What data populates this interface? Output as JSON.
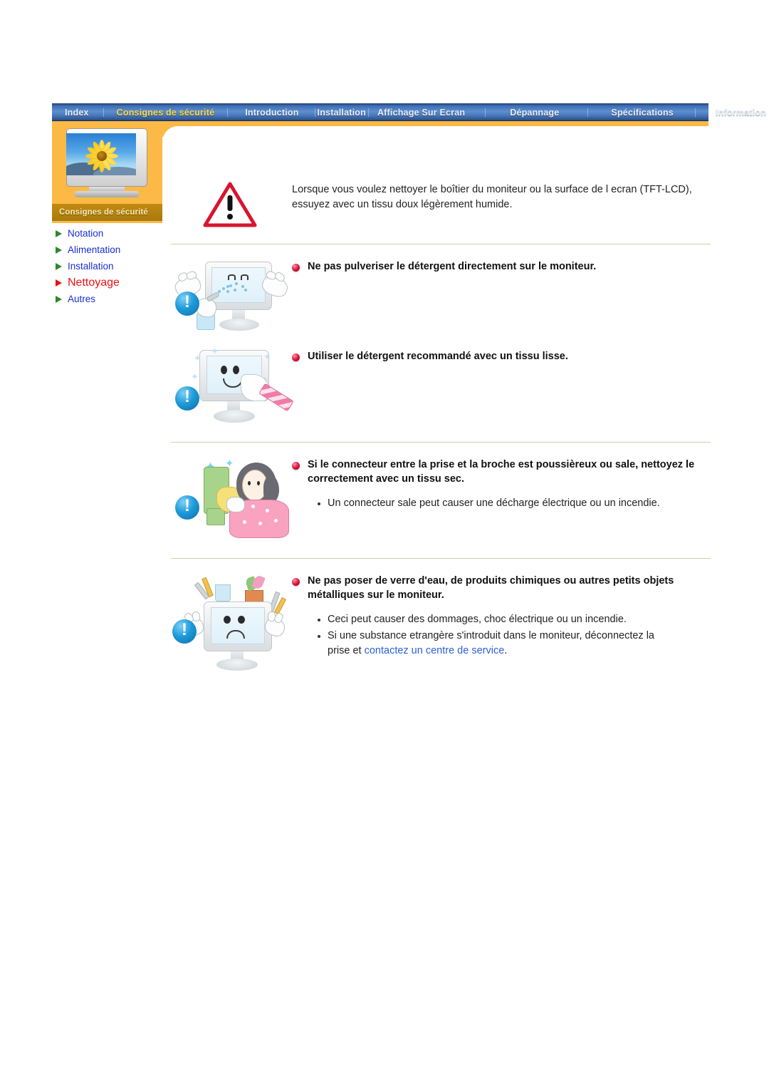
{
  "nav": {
    "items": [
      {
        "label": "Index",
        "active": false
      },
      {
        "label": "Consignes de sécurité",
        "active": true
      },
      {
        "label": "Introduction",
        "active": false
      },
      {
        "label": "Installation",
        "active": false
      },
      {
        "label": "Affichage Sur Ecran",
        "active": false
      },
      {
        "label": "Dépannage",
        "active": false
      },
      {
        "label": "Spécifications",
        "active": false
      },
      {
        "label": "Information",
        "active": false
      }
    ]
  },
  "sidebar": {
    "panel_caption": "Consignes de sécurité",
    "thumb_icon": "monitor-sunflower-icon",
    "links": [
      {
        "label": "Notation",
        "active": false
      },
      {
        "label": "Alimentation",
        "active": false
      },
      {
        "label": "Installation",
        "active": false
      },
      {
        "label": "Nettoyage",
        "active": true
      },
      {
        "label": "Autres",
        "active": false
      }
    ]
  },
  "content": {
    "intro": {
      "icon": "warning-triangle-icon",
      "text": "Lorsque vous voulez nettoyer le boîtier du moniteur ou la surface de l ecran (TFT-LCD), essuyez avec un tissu doux légèrement humide."
    },
    "sections": [
      {
        "illustration": "monitor-spray-bottle-icon",
        "badge": "blue-exclamation-icon",
        "bullet": "red-sphere-bullet-icon",
        "heading": "Ne pas pulveriser le détergent directement sur le moniteur.",
        "items": []
      },
      {
        "illustration": "monitor-wipe-cloth-icon",
        "badge": "blue-exclamation-icon",
        "bullet": "red-sphere-bullet-icon",
        "heading": "Utiliser le détergent recommandé avec un tissu lisse.",
        "items": []
      },
      {
        "illustration": "woman-cleaning-plug-icon",
        "badge": "blue-exclamation-icon",
        "bullet": "red-sphere-bullet-icon",
        "heading": "Si le connecteur entre la prise et la broche est poussièreux ou sale, nettoyez le correctement avec un tissu sec.",
        "items": [
          {
            "text": "Un connecteur sale peut causer une décharge électrique ou un incendie."
          }
        ]
      },
      {
        "illustration": "sad-monitor-objects-icon",
        "badge": "blue-exclamation-icon",
        "bullet": "red-sphere-bullet-icon",
        "heading": "Ne pas poser de verre d'eau, de produits chimiques ou autres petits objets métalliques sur le moniteur.",
        "items": [
          {
            "text": "Ceci peut causer des dommages, choc électrique ou un incendie."
          },
          {
            "text_before": "Si une substance etrangère s'introduit dans le moniteur, déconnectez la prise et ",
            "link": "contactez un centre de service",
            "text_after": "."
          }
        ]
      }
    ]
  },
  "colors": {
    "nav_active": "#ffd94a",
    "sidebar_link": "#1a2fd0",
    "sidebar_active": "#ee1111",
    "orange_panel": "#fcb945",
    "inline_link": "#2b5fd9",
    "rule": "#d5cbb0"
  }
}
